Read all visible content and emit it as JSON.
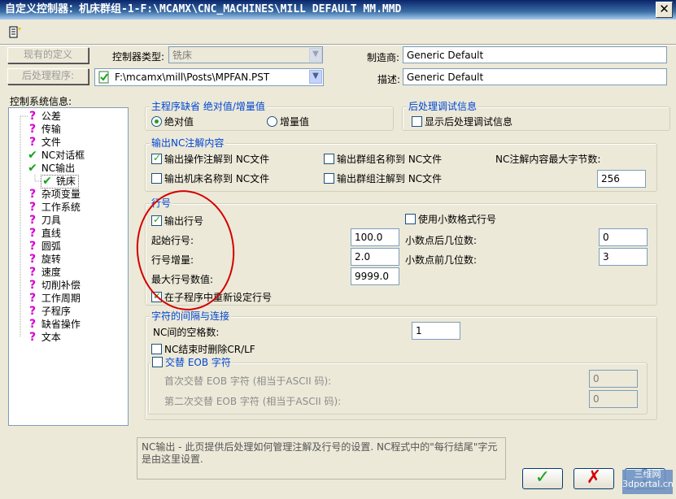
{
  "window": {
    "title": "自定义控制器：机床群组-1-F:\\MCAMX\\CNC_MACHINES\\MILL DEFAULT MM.MMD",
    "close_glyph": "✕"
  },
  "toolbar": {
    "icon": "edit-definition-icon"
  },
  "top": {
    "existing_def_button": "现有的定义",
    "post_program_button": "后处理程序:",
    "controller_type_label": "控制器类型:",
    "controller_type_value": "铣床",
    "post_path": "F:\\mcamx\\mill\\Posts\\MPFAN.PST",
    "manufacturer_label": "制造商:",
    "manufacturer_value": "Generic Default",
    "description_label": "描述:",
    "description_value": "Generic Default"
  },
  "sidebar": {
    "title": "控制系统信息:",
    "items": [
      {
        "label": "公差",
        "state": "unknown"
      },
      {
        "label": "传输",
        "state": "unknown"
      },
      {
        "label": "文件",
        "state": "unknown"
      },
      {
        "label": "NC对话框",
        "state": "ok"
      },
      {
        "label": "NC输出",
        "state": "ok"
      },
      {
        "label": "铣床",
        "state": "ok",
        "child": true,
        "selected": true
      },
      {
        "label": "杂项变量",
        "state": "unknown"
      },
      {
        "label": "工作系统",
        "state": "unknown"
      },
      {
        "label": "刀具",
        "state": "unknown"
      },
      {
        "label": "直线",
        "state": "unknown"
      },
      {
        "label": "圆弧",
        "state": "unknown"
      },
      {
        "label": "旋转",
        "state": "unknown"
      },
      {
        "label": "速度",
        "state": "unknown"
      },
      {
        "label": "切削补偿",
        "state": "unknown"
      },
      {
        "label": "工作周期",
        "state": "unknown"
      },
      {
        "label": "子程序",
        "state": "unknown"
      },
      {
        "label": "缺省操作",
        "state": "unknown"
      },
      {
        "label": "文本",
        "state": "unknown"
      }
    ]
  },
  "main_prog": {
    "title": "主程序缺省 绝对值/增量值",
    "absolute": "绝对值",
    "incremental": "增量值",
    "selected": "绝对值"
  },
  "post_debug": {
    "title": "后处理调试信息",
    "show_debug": "显示后处理调试信息",
    "checked": false
  },
  "nc_comments": {
    "title": "输出NC注解内容",
    "output_op_comments": "输出操作注解到 NC文件",
    "output_op_comments_checked": true,
    "output_group_name": "输出群组名称到 NC文件",
    "output_group_name_checked": false,
    "output_machine_name": "输出机床名称到 NC文件",
    "output_machine_name_checked": false,
    "output_group_comments": "输出群组注解到 NC文件",
    "output_group_comments_checked": false,
    "max_chars_label": "NC注解内容最大字节数:",
    "max_chars_value": "256"
  },
  "line_numbers": {
    "title": "行号",
    "output_line_numbers": "输出行号",
    "output_line_numbers_checked": true,
    "start_label": "起始行号:",
    "start_value": "100.0",
    "increment_label": "行号增量:",
    "increment_value": "2.0",
    "max_label": "最大行号数值:",
    "max_value": "9999.0",
    "reset_in_sub": "在子程序中重新设定行号",
    "reset_in_sub_checked": true,
    "use_decimal": "使用小数格式行号",
    "use_decimal_checked": false,
    "digits_after_label": "小数点后几位数:",
    "digits_after_value": "0",
    "digits_before_label": "小数点前几位数:",
    "digits_before_value": "3"
  },
  "char_spacing": {
    "title": "字符的间隔与连接",
    "nc_spaces_label": "NC间的空格数:",
    "nc_spaces_value": "1",
    "strip_crlf": "NC结束时删除CR/LF",
    "strip_crlf_checked": false,
    "alt_eob": "交替 EOB 字符",
    "alt_eob_checked": false,
    "first_eob_label": "首次交替 EOB 字符 (相当于ASCII 码):",
    "first_eob_value": "0",
    "second_eob_label": "第二次交替 EOB 字符 (相当于ASCII 码):",
    "second_eob_value": "0"
  },
  "help_text": "NC输出 - 此页提供后处理如何管理注解及行号的设置. NC程式中的\"每行结尾\"字元是由这里设置.",
  "buttons": {
    "ok": "✓",
    "cancel": "✗",
    "help": "?"
  },
  "watermark": "三维网 3dportal.cn",
  "colors": {
    "group_title": "#0046d5",
    "check_green": "#21a121",
    "unknown_magenta": "#d400d4",
    "annotation_red": "#d40000"
  }
}
